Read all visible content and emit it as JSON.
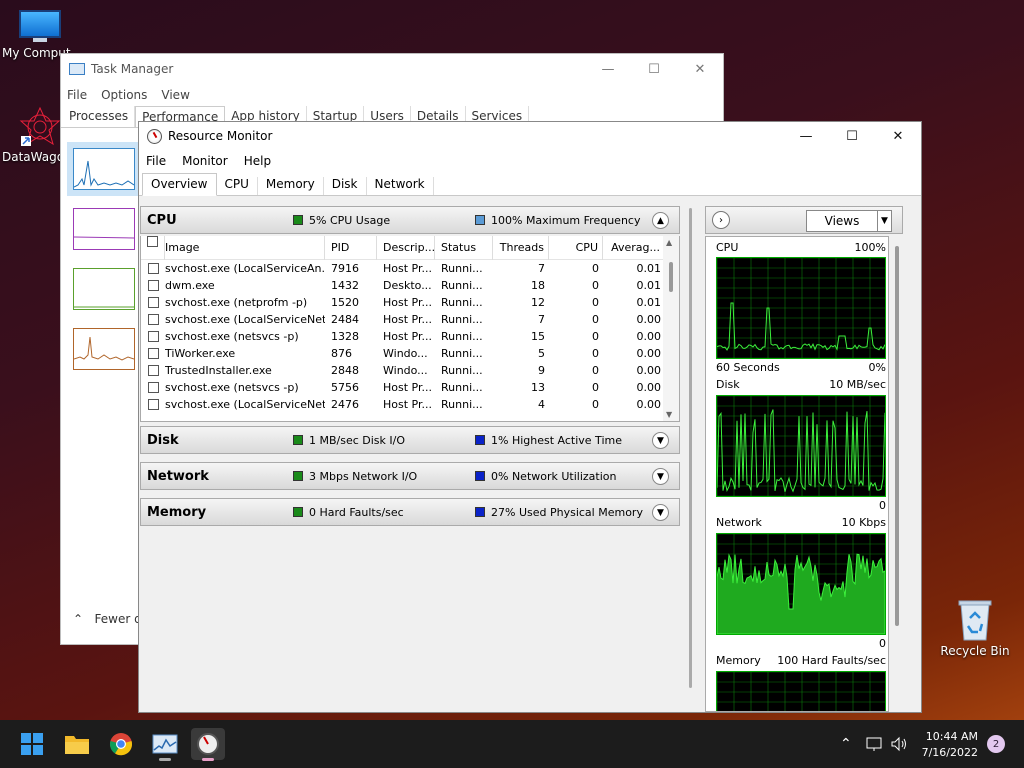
{
  "desktop": {
    "icons": [
      {
        "label": "My Comput"
      },
      {
        "label": "DataWagon"
      },
      {
        "label": "Recycle Bin"
      }
    ]
  },
  "task_manager": {
    "title": "Task Manager",
    "menu": [
      "File",
      "Options",
      "View"
    ],
    "tabs": [
      "Processes",
      "Performance",
      "App history",
      "Startup",
      "Users",
      "Details",
      "Services"
    ],
    "active_tab": "Performance",
    "fewer_details": "Fewer de"
  },
  "resource_monitor": {
    "title": "Resource Monitor",
    "menu": [
      "File",
      "Monitor",
      "Help"
    ],
    "tabs": [
      "Overview",
      "CPU",
      "Memory",
      "Disk",
      "Network"
    ],
    "active_tab": "Overview",
    "cpu": {
      "title": "CPU",
      "usage": "5% CPU Usage",
      "frequency": "100% Maximum Frequency",
      "usage_color": "#1a8a1a",
      "frequency_color": "#5b9bd5"
    },
    "columns": [
      "Image",
      "PID",
      "Descrip...",
      "Status",
      "Threads",
      "CPU",
      "Averag..."
    ],
    "processes": [
      {
        "image": "svchost.exe (LocalServiceAn...",
        "pid": "7916",
        "desc": "Host Pr...",
        "status": "Runni...",
        "threads": "7",
        "cpu": "0",
        "avg": "0.01"
      },
      {
        "image": "dwm.exe",
        "pid": "1432",
        "desc": "Deskto...",
        "status": "Runni...",
        "threads": "18",
        "cpu": "0",
        "avg": "0.01"
      },
      {
        "image": "svchost.exe (netprofm -p)",
        "pid": "1520",
        "desc": "Host Pr...",
        "status": "Runni...",
        "threads": "12",
        "cpu": "0",
        "avg": "0.01"
      },
      {
        "image": "svchost.exe (LocalServiceNet...",
        "pid": "2484",
        "desc": "Host Pr...",
        "status": "Runni...",
        "threads": "7",
        "cpu": "0",
        "avg": "0.00"
      },
      {
        "image": "svchost.exe (netsvcs -p)",
        "pid": "1328",
        "desc": "Host Pr...",
        "status": "Runni...",
        "threads": "15",
        "cpu": "0",
        "avg": "0.00"
      },
      {
        "image": "TiWorker.exe",
        "pid": "876",
        "desc": "Windo...",
        "status": "Runni...",
        "threads": "5",
        "cpu": "0",
        "avg": "0.00"
      },
      {
        "image": "TrustedInstaller.exe",
        "pid": "2848",
        "desc": "Windo...",
        "status": "Runni...",
        "threads": "9",
        "cpu": "0",
        "avg": "0.00"
      },
      {
        "image": "svchost.exe (netsvcs -p)",
        "pid": "5756",
        "desc": "Host Pr...",
        "status": "Runni...",
        "threads": "13",
        "cpu": "0",
        "avg": "0.00"
      },
      {
        "image": "svchost.exe (LocalServiceNet...",
        "pid": "2476",
        "desc": "Host Pr...",
        "status": "Runni...",
        "threads": "4",
        "cpu": "0",
        "avg": "0.00"
      }
    ],
    "disk": {
      "title": "Disk",
      "io": "1 MB/sec Disk I/O",
      "active": "1% Highest Active Time",
      "io_color": "#1a8a1a",
      "active_color": "#0a22c8"
    },
    "network": {
      "title": "Network",
      "io": "3 Mbps Network I/O",
      "util": "0% Network Utilization",
      "io_color": "#1a8a1a",
      "util_color": "#0a22c8"
    },
    "memory": {
      "title": "Memory",
      "faults": "0 Hard Faults/sec",
      "used": "27% Used Physical Memory",
      "faults_color": "#1a8a1a",
      "used_color": "#0a22c8"
    },
    "views_label": "Views",
    "graphs": {
      "cpu": {
        "name": "CPU",
        "max": "100%",
        "time": "60 Seconds",
        "min": "0%"
      },
      "disk": {
        "name": "Disk",
        "max": "10 MB/sec",
        "min": "0"
      },
      "network": {
        "name": "Network",
        "max": "10 Kbps",
        "min": "0"
      },
      "memory": {
        "name": "Memory",
        "max": "100 Hard Faults/sec"
      }
    }
  },
  "taskbar": {
    "time": "10:44 AM",
    "date": "7/16/2022",
    "notifications": "2"
  }
}
